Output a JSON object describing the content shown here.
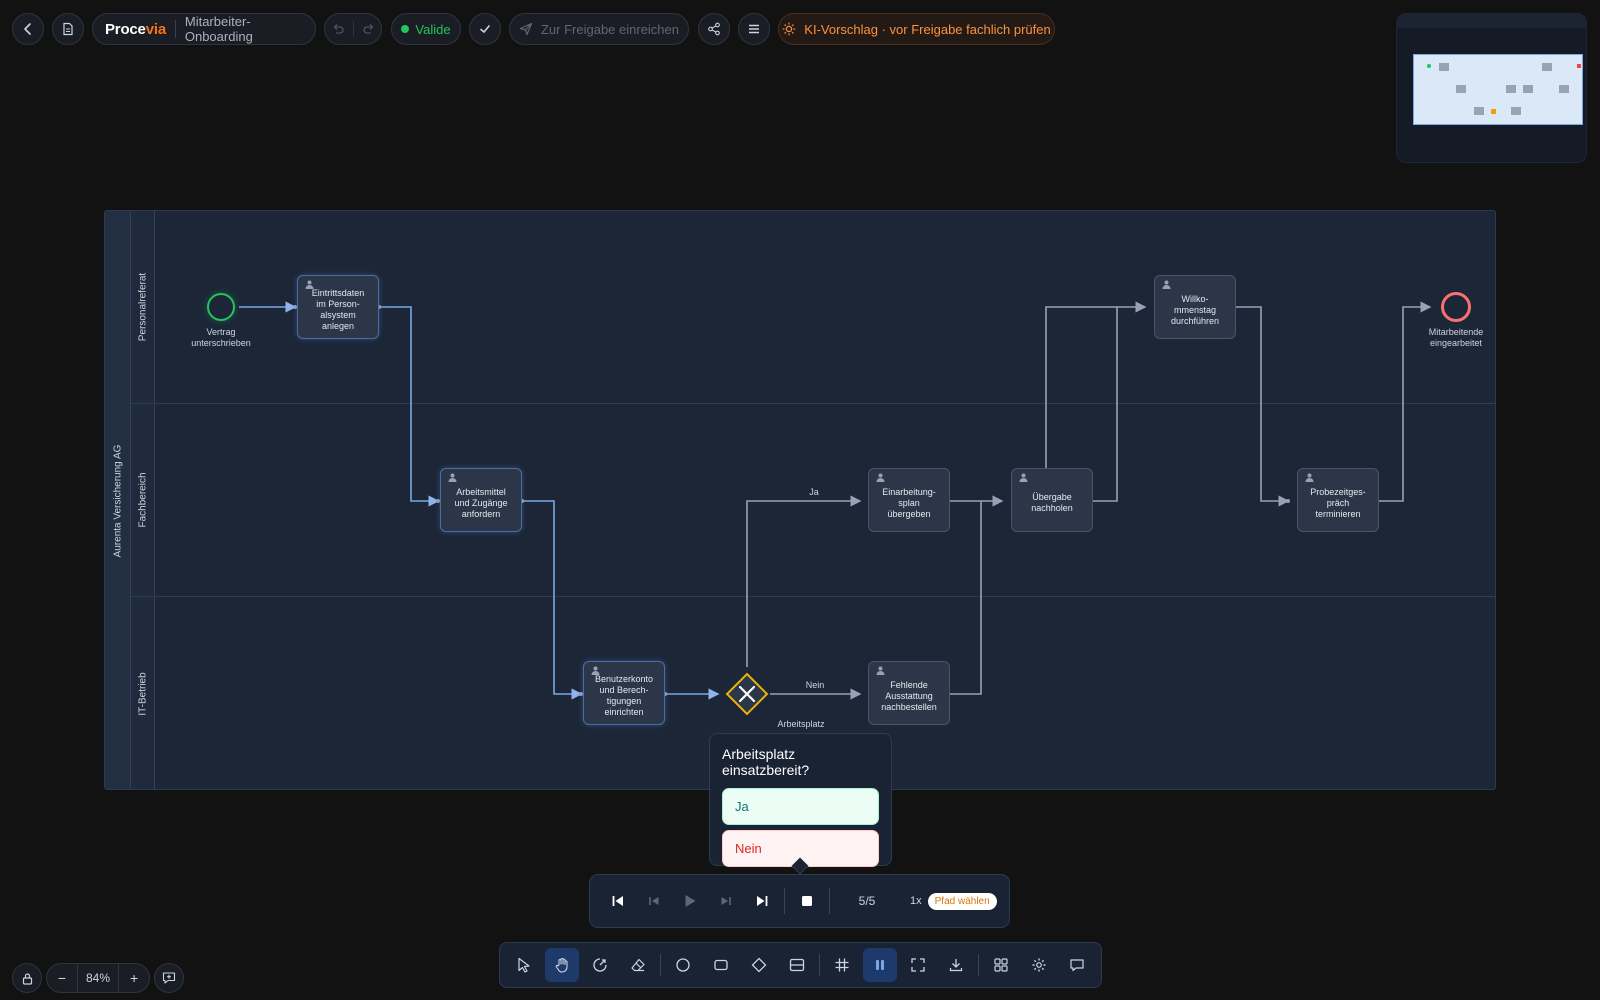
{
  "header": {
    "brand_main": "Proce",
    "brand_accent": "via",
    "document_title": "Mitarbeiter-Onboarding",
    "status_label": "Valide",
    "submit_label": "Zur Freigabe einreichen",
    "ai_hint": "KI-Vorschlag · vor Freigabe fachlich prüfen"
  },
  "diagram": {
    "pool": "Aurenta Versicherung AG",
    "lanes": [
      "Personalreferat",
      "Fachbereich",
      "IT-Betrieb"
    ],
    "start_event": "Vertrag\nunterschrieben",
    "end_event": "Mitarbeitende\neingearbeitet",
    "gateway_label": "Arbeitsplatz\neinsatzbereit?",
    "tasks": [
      "Eintrittsdaten\nim Person-\nalsystem\nanlegen",
      "Arbeitsmittel\nund Zugänge\nanfordern",
      "Benutzerkonto\nund Berech-\ntigungen\neinrichten",
      "Einarbeitung-\nsplan\nübergeben",
      "Fehlende\nAusstattung\nnachbestellen",
      "Übergabe\nnachholen",
      "Willko-\nmmenstag\ndurchführen",
      "Probezeitges-\npräch\nterminieren"
    ],
    "flow_labels": {
      "yes": "Ja",
      "no": "Nein"
    }
  },
  "decision": {
    "question": "Arbeitsplatz einsatzbereit?",
    "yes": "Ja",
    "no": "Nein"
  },
  "player": {
    "step": "5/5",
    "speed": "1x",
    "path_button": "Pfad wählen"
  },
  "zoom": {
    "level": "84%",
    "minus": "−",
    "plus": "+"
  },
  "colors": {
    "accent": "#f97316",
    "valid": "#22c55e",
    "start": "#22c55e",
    "end": "#f87171",
    "gateway": "#eab308",
    "active_path": "#7aa7e6"
  }
}
